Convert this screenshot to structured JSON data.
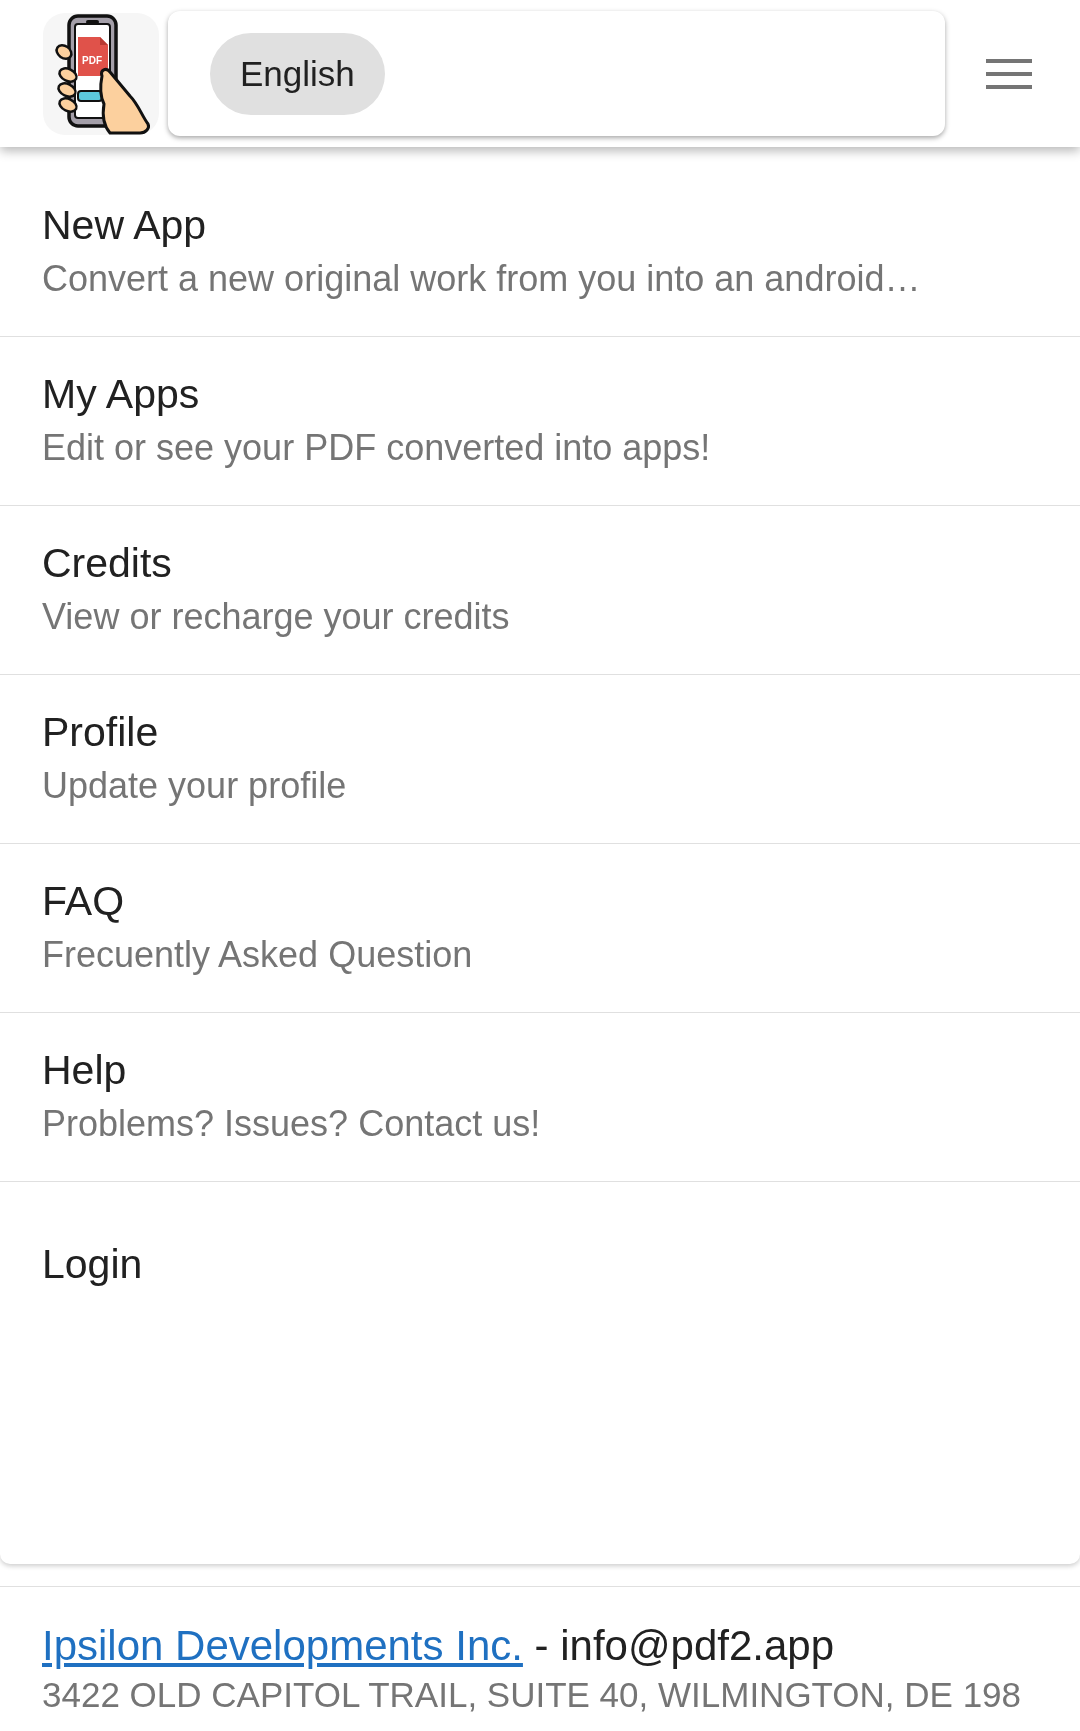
{
  "header": {
    "logo_text": "PDF",
    "language": "English"
  },
  "menu": [
    {
      "title": "New App",
      "description": "Convert a new original work from you into an android…"
    },
    {
      "title": "My Apps",
      "description": "Edit or see your PDF converted into apps!"
    },
    {
      "title": "Credits",
      "description": "View or recharge your credits"
    },
    {
      "title": "Profile",
      "description": "Update your profile"
    },
    {
      "title": "FAQ",
      "description": "Frecuently Asked Question"
    },
    {
      "title": "Help",
      "description": "Problems? Issues? Contact us!"
    }
  ],
  "login": "Login",
  "footer": {
    "company_link": "Ipsilon Developments Inc.",
    "contact": "- info@pdf2.app",
    "address": "3422 OLD CAPITOL TRAIL, SUITE 40, WILMINGTON, DE 198"
  }
}
